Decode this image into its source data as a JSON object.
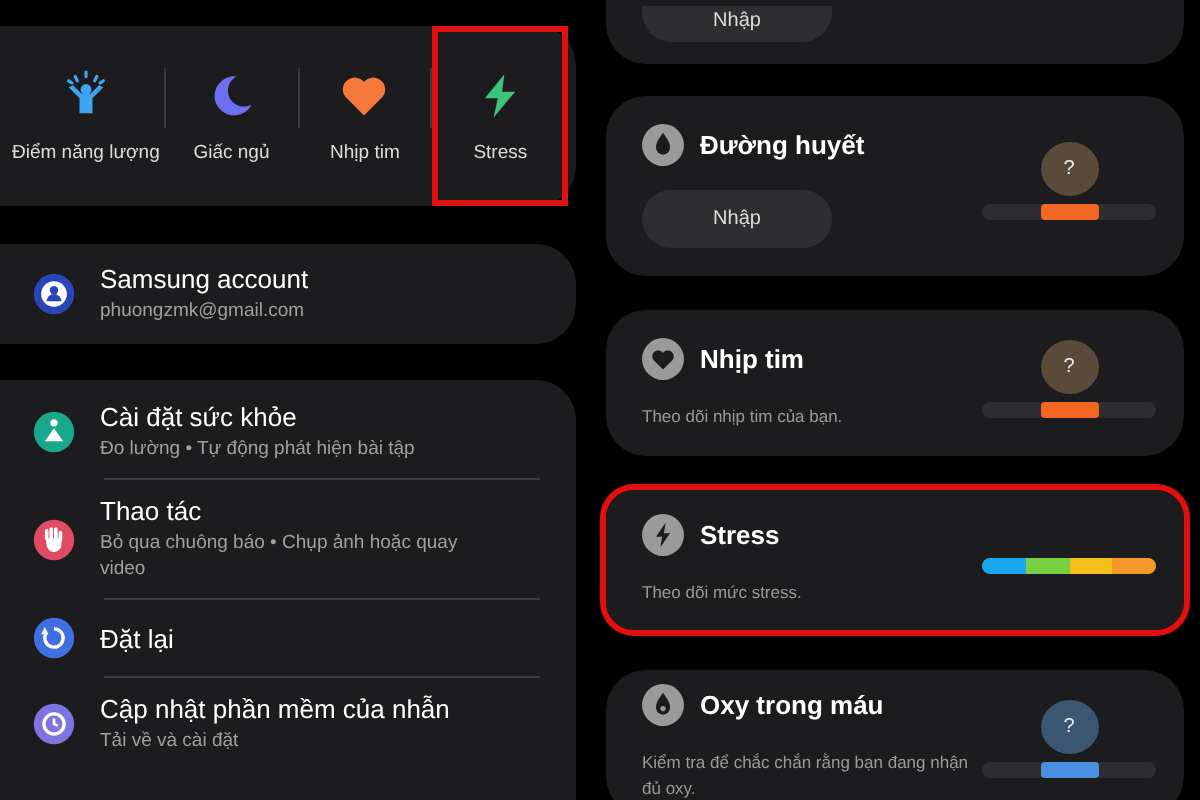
{
  "shortcuts": [
    {
      "kind": "energy",
      "label": "Điểm năng lượng",
      "highlighted": false
    },
    {
      "kind": "sleep",
      "label": "Giấc ngủ",
      "highlighted": false
    },
    {
      "kind": "heart",
      "label": "Nhịp tim",
      "highlighted": false
    },
    {
      "kind": "stress",
      "label": "Stress",
      "highlighted": true
    }
  ],
  "account": {
    "title": "Samsung account",
    "email": "phuongzmk@gmail.com"
  },
  "settings": [
    {
      "kind": "health",
      "title": "Cài đặt sức khỏe",
      "subtitle": "Đo lường • Tự động phát hiện bài tập"
    },
    {
      "kind": "gesture",
      "title": "Thao tác",
      "subtitle": "Bỏ qua chuông báo  •  Chụp ảnh hoặc quay video"
    },
    {
      "kind": "reset",
      "title": "Đặt lại"
    },
    {
      "kind": "update",
      "title": "Cập nhật phần mềm của nhẫn",
      "subtitle": "Tải về và cài đặt"
    }
  ],
  "top_card": {
    "button": "Nhập"
  },
  "metrics": [
    {
      "kind": "drop",
      "title": "Đường huyết",
      "button": "Nhập",
      "highlighted": false,
      "gauge": {
        "kind": "marker",
        "badge": "?",
        "color": "#f26522",
        "level": 0.5
      }
    },
    {
      "kind": "heart",
      "title": "Nhịp tim",
      "description": "Theo dõi nhịp tim của bạn.",
      "highlighted": false,
      "gauge": {
        "kind": "marker",
        "badge": "?",
        "color": "#f26522",
        "level": 0.5
      }
    },
    {
      "kind": "stress",
      "title": "Stress",
      "description": "Theo dõi mức stress.",
      "highlighted": true,
      "gauge": {
        "kind": "spectrum"
      }
    },
    {
      "kind": "oxygen",
      "title": "Oxy trong máu",
      "description": "Kiểm tra để chắc chắn rằng bạn đang nhận đủ oxy.",
      "highlighted": false,
      "gauge": {
        "kind": "marker",
        "badge": "?",
        "color": "#4a90e2",
        "level": 0.5
      }
    }
  ]
}
